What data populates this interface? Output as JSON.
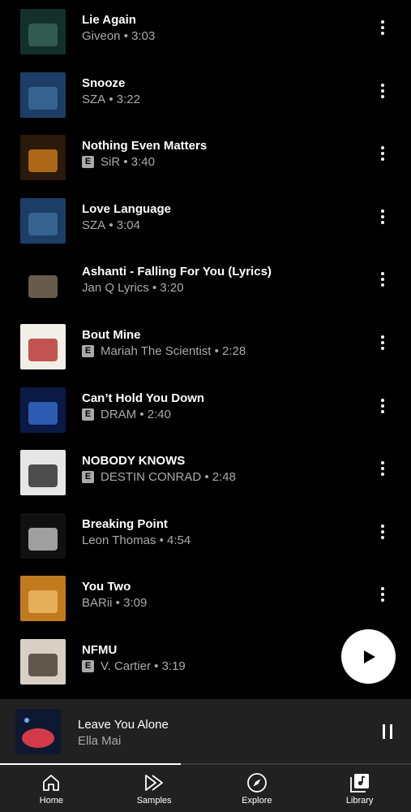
{
  "songs": [
    {
      "title": "Lie Again",
      "artist": "Giveon",
      "duration": "3:03",
      "explicit": false,
      "art": [
        "#14302a",
        "#3c6a5e"
      ]
    },
    {
      "title": "Snooze",
      "artist": "SZA",
      "duration": "3:22",
      "explicit": false,
      "art": [
        "#1c3e66",
        "#3f6f9e"
      ]
    },
    {
      "title": "Nothing Even Matters",
      "artist": "SiR",
      "duration": "3:40",
      "explicit": true,
      "art": [
        "#2a1a0c",
        "#d9821e"
      ]
    },
    {
      "title": "Love Language",
      "artist": "SZA",
      "duration": "3:04",
      "explicit": false,
      "art": [
        "#1c3e66",
        "#3f6f9e"
      ]
    },
    {
      "title": "Ashanti - Falling For You (Lyrics)",
      "artist": "Jan Q Lyrics",
      "duration": "3:20",
      "explicit": false,
      "art": [
        "#000000",
        "#8a7a66"
      ]
    },
    {
      "title": "Bout Mine",
      "artist": "Mariah The Scientist",
      "duration": "2:28",
      "explicit": true,
      "art": [
        "#f2eee8",
        "#b0201e"
      ]
    },
    {
      "title": "Can’t Hold You Down",
      "artist": "DRAM",
      "duration": "2:40",
      "explicit": true,
      "art": [
        "#0a1a44",
        "#3a72d6"
      ]
    },
    {
      "title": "NOBODY KNOWS",
      "artist": "DESTIN CONRAD",
      "duration": "2:48",
      "explicit": true,
      "art": [
        "#e6e6e6",
        "#1a1a1a"
      ]
    },
    {
      "title": "Breaking Point",
      "artist": "Leon Thomas",
      "duration": "4:54",
      "explicit": false,
      "art": [
        "#101010",
        "#cfcfcf"
      ]
    },
    {
      "title": "You Two",
      "artist": "BARii",
      "duration": "3:09",
      "explicit": false,
      "art": [
        "#c27a1e",
        "#f0c070"
      ]
    },
    {
      "title": "NFMU",
      "artist": "V. Cartier",
      "duration": "3:19",
      "explicit": true,
      "art": [
        "#d8d0c4",
        "#3a3026"
      ]
    }
  ],
  "now_playing": {
    "title": "Leave You Alone",
    "artist": "Ella Mai",
    "progress": 0.44,
    "art": [
      "#0e1830",
      "#d23a4a"
    ]
  },
  "nav": [
    {
      "label": "Home",
      "icon": "home-icon"
    },
    {
      "label": "Samples",
      "icon": "samples-icon"
    },
    {
      "label": "Explore",
      "icon": "compass-icon"
    },
    {
      "label": "Library",
      "icon": "library-icon"
    }
  ]
}
